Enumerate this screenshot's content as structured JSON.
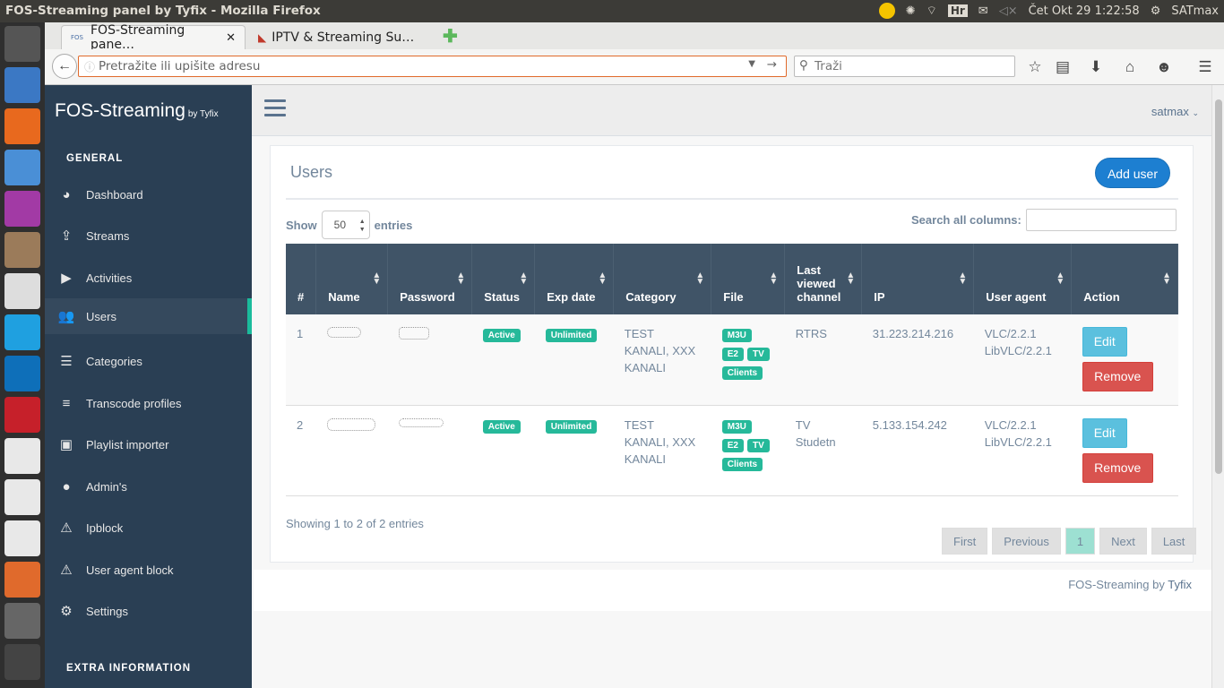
{
  "system": {
    "window_title": "FOS-Streaming panel by Tyfix - Mozilla Firefox",
    "keyboard_layout": "Hr",
    "clock": "Čet Okt 29  1:22:58",
    "user": "SATmax"
  },
  "browser": {
    "tabs": [
      {
        "label": "FOS-Streaming pane…",
        "favicon_text": "FOS"
      },
      {
        "label": "IPTV & Streaming Su…"
      }
    ],
    "url_placeholder": "Pretražite ili upišite adresu",
    "search_placeholder": "Traži"
  },
  "sidebar": {
    "brand": "FOS-Streaming",
    "brand_by": "by Tyfix",
    "section_general": "GENERAL",
    "section_extra": "EXTRA INFORMATION",
    "items": [
      {
        "label": "Dashboard",
        "icon": "dashboard-icon"
      },
      {
        "label": "Streams",
        "icon": "upload-icon"
      },
      {
        "label": "Activities",
        "icon": "play-icon"
      },
      {
        "label": "Users",
        "icon": "users-icon"
      },
      {
        "label": "Categories",
        "icon": "list-icon"
      },
      {
        "label": "Transcode profiles",
        "icon": "bars-icon"
      },
      {
        "label": "Playlist importer",
        "icon": "archive-icon"
      },
      {
        "label": "Admin's",
        "icon": "user-icon"
      },
      {
        "label": "Ipblock",
        "icon": "warning-icon"
      },
      {
        "label": "User agent block",
        "icon": "warning-icon"
      },
      {
        "label": "Settings",
        "icon": "gear-icon"
      }
    ]
  },
  "header": {
    "username": "satmax"
  },
  "panel": {
    "title": "Users",
    "add_button": "Add user",
    "show_label": "Show",
    "entries_value": "50",
    "entries_label": "entries",
    "search_label": "Search all columns:",
    "columns": [
      "#",
      "Name",
      "Password",
      "Status",
      "Exp date",
      "Category",
      "File",
      "Last viewed channel",
      "IP",
      "User agent",
      "Action"
    ],
    "rows": [
      {
        "num": "1",
        "status": "Active",
        "exp": "Unlimited",
        "category": "TEST KANALI, XXX KANALI",
        "files": [
          "M3U",
          "E2",
          "TV",
          "Clients"
        ],
        "channel": "RTRS",
        "ip": "31.223.214.216",
        "agent": "VLC/2.2.1 LibVLC/2.2.1",
        "edit": "Edit",
        "remove": "Remove"
      },
      {
        "num": "2",
        "status": "Active",
        "exp": "Unlimited",
        "category": "TEST KANALI, XXX KANALI",
        "files": [
          "M3U",
          "E2",
          "TV",
          "Clients"
        ],
        "channel": "TV Studetn",
        "ip": "5.133.154.242",
        "agent": "VLC/2.2.1 LibVLC/2.2.1",
        "edit": "Edit",
        "remove": "Remove"
      }
    ],
    "info": "Showing 1 to 2 of 2 entries",
    "pagination": [
      "First",
      "Previous",
      "1",
      "Next",
      "Last"
    ]
  },
  "footer": {
    "text": "FOS-Streaming by",
    "link": "Tyfix"
  }
}
